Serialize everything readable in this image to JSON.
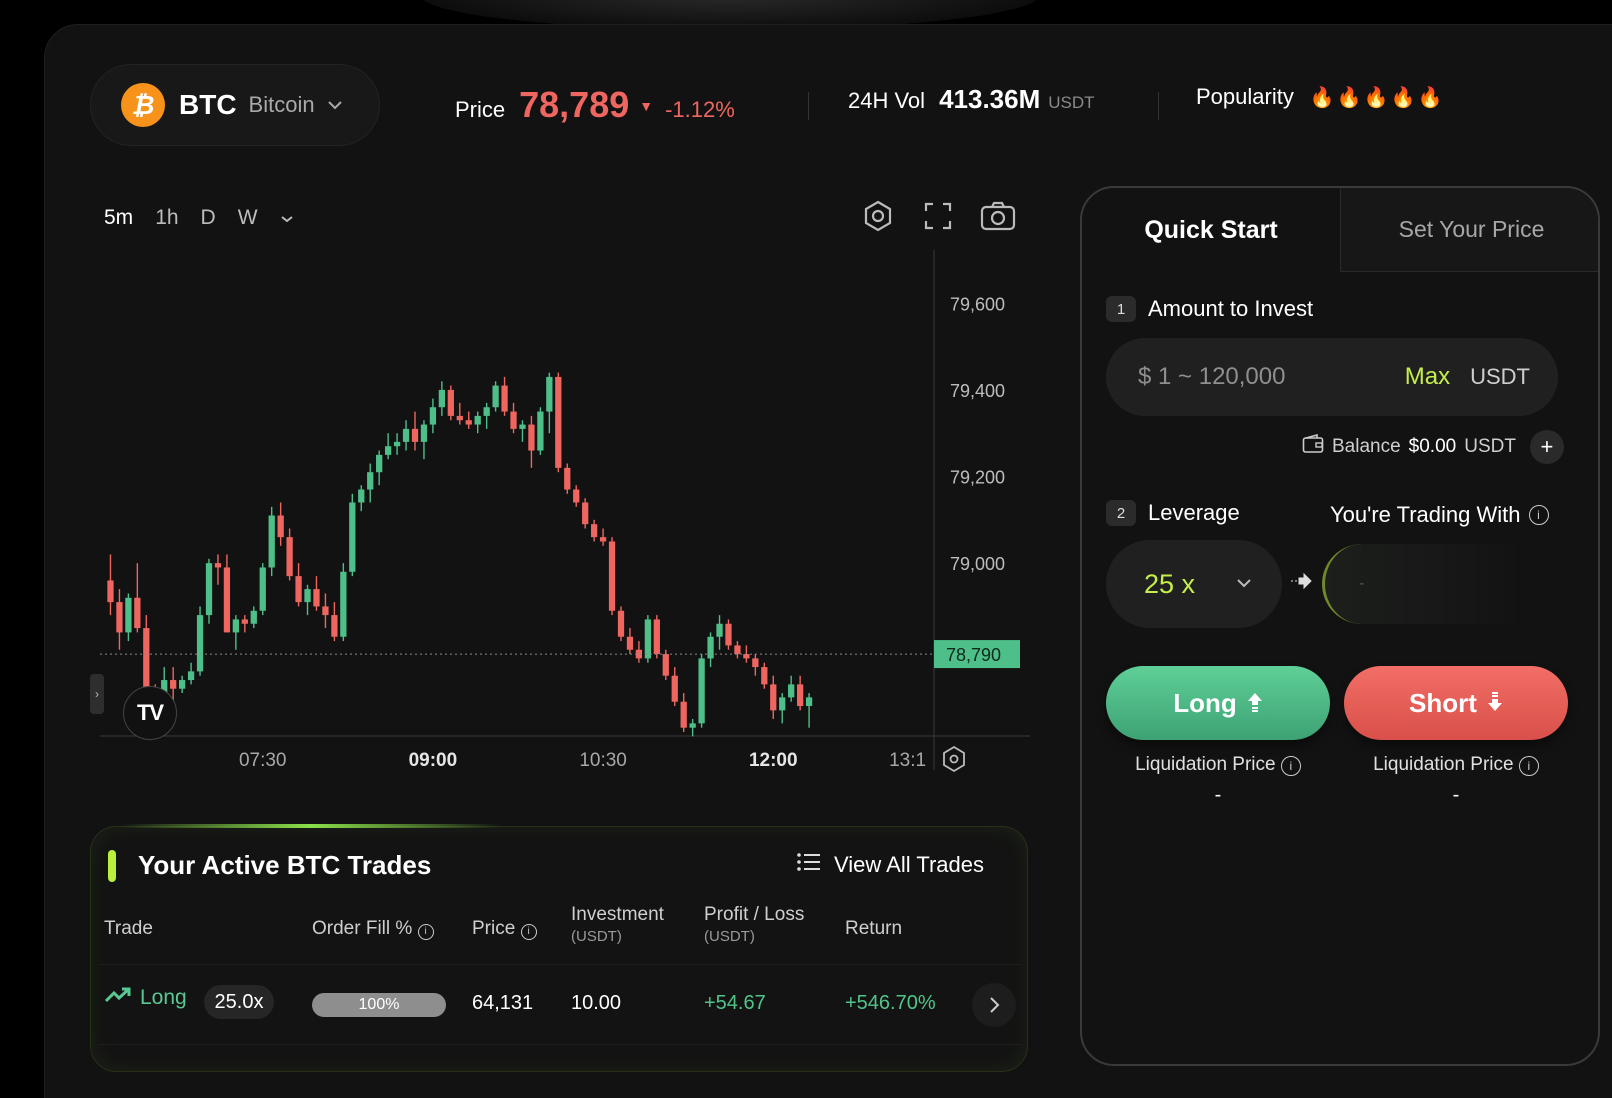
{
  "header": {
    "coin_symbol": "BTC",
    "coin_name": "Bitcoin",
    "price_label": "Price",
    "price_value": "78,789",
    "price_change": "-1.12%",
    "volume_label": "24H Vol",
    "volume_value": "413.36M",
    "volume_unit": "USDT",
    "popularity_label": "Popularity",
    "popularity_level": 5
  },
  "chart": {
    "timeframes": [
      "5m",
      "1h",
      "D",
      "W"
    ],
    "active_timeframe": "5m",
    "current_price_tag": "78,790",
    "colors": {
      "up": "#4fbf8a",
      "down": "#ef6660",
      "current": "#4fbf8a"
    }
  },
  "chart_data": {
    "type": "candlestick",
    "title": "",
    "ylim": [
      78550,
      79700
    ],
    "yticks": [
      "79,600",
      "79,400",
      "79,200",
      "79,000"
    ],
    "xticks": [
      {
        "label": "07:30",
        "bold": false,
        "index": 17
      },
      {
        "label": "09:00",
        "bold": true,
        "index": 36
      },
      {
        "label": "10:30",
        "bold": false,
        "index": 55
      },
      {
        "label": "12:00",
        "bold": true,
        "index": 74
      },
      {
        "label": "13:1",
        "bold": false,
        "index": 89
      }
    ],
    "current_price": 78790,
    "candles": [
      [
        78960,
        79020,
        78880,
        78910
      ],
      [
        78910,
        78940,
        78800,
        78840
      ],
      [
        78840,
        78930,
        78820,
        78920
      ],
      [
        78920,
        79000,
        78840,
        78850
      ],
      [
        78850,
        78880,
        78660,
        78700
      ],
      [
        78700,
        78720,
        78600,
        78620
      ],
      [
        78620,
        78760,
        78610,
        78730
      ],
      [
        78730,
        78760,
        78650,
        78710
      ],
      [
        78710,
        78740,
        78700,
        78730
      ],
      [
        78730,
        78770,
        78720,
        78750
      ],
      [
        78750,
        78900,
        78740,
        78880
      ],
      [
        78880,
        79010,
        78860,
        79000
      ],
      [
        79000,
        79020,
        78950,
        78990
      ],
      [
        78990,
        79020,
        78840,
        78840
      ],
      [
        78840,
        78880,
        78800,
        78870
      ],
      [
        78870,
        78880,
        78840,
        78860
      ],
      [
        78860,
        78900,
        78850,
        78890
      ],
      [
        78890,
        79000,
        78880,
        78990
      ],
      [
        78990,
        79130,
        78970,
        79110
      ],
      [
        79110,
        79140,
        79040,
        79060
      ],
      [
        79060,
        79080,
        78960,
        78970
      ],
      [
        78970,
        79000,
        78900,
        78910
      ],
      [
        78910,
        78950,
        78880,
        78940
      ],
      [
        78940,
        78970,
        78890,
        78900
      ],
      [
        78900,
        78930,
        78850,
        78880
      ],
      [
        78880,
        78910,
        78820,
        78830
      ],
      [
        78830,
        79000,
        78820,
        78980
      ],
      [
        78980,
        79160,
        78970,
        79140
      ],
      [
        79140,
        79180,
        79120,
        79170
      ],
      [
        79170,
        79230,
        79140,
        79210
      ],
      [
        79210,
        79260,
        79180,
        79250
      ],
      [
        79250,
        79300,
        79240,
        79270
      ],
      [
        79270,
        79300,
        79250,
        79280
      ],
      [
        79280,
        79330,
        79260,
        79310
      ],
      [
        79310,
        79350,
        79260,
        79280
      ],
      [
        79280,
        79330,
        79240,
        79320
      ],
      [
        79320,
        79380,
        79300,
        79360
      ],
      [
        79360,
        79420,
        79340,
        79400
      ],
      [
        79400,
        79410,
        79330,
        79340
      ],
      [
        79340,
        79370,
        79320,
        79330
      ],
      [
        79330,
        79350,
        79310,
        79320
      ],
      [
        79320,
        79350,
        79300,
        79340
      ],
      [
        79340,
        79370,
        79310,
        79360
      ],
      [
        79360,
        79420,
        79350,
        79410
      ],
      [
        79410,
        79430,
        79340,
        79350
      ],
      [
        79350,
        79370,
        79300,
        79310
      ],
      [
        79310,
        79330,
        79280,
        79320
      ],
      [
        79320,
        79340,
        79220,
        79260
      ],
      [
        79260,
        79360,
        79250,
        79350
      ],
      [
        79350,
        79440,
        79300,
        79430
      ],
      [
        79430,
        79440,
        79210,
        79220
      ],
      [
        79220,
        79230,
        79160,
        79170
      ],
      [
        79170,
        79180,
        79130,
        79140
      ],
      [
        79140,
        79150,
        79080,
        79090
      ],
      [
        79090,
        79100,
        79050,
        79060
      ],
      [
        79060,
        79080,
        79040,
        79050
      ],
      [
        79050,
        79060,
        78880,
        78890
      ],
      [
        78890,
        78900,
        78820,
        78830
      ],
      [
        78830,
        78850,
        78790,
        78800
      ],
      [
        78800,
        78820,
        78770,
        78780
      ],
      [
        78780,
        78880,
        78770,
        78870
      ],
      [
        78870,
        78880,
        78780,
        78790
      ],
      [
        78790,
        78800,
        78730,
        78740
      ],
      [
        78740,
        78760,
        78670,
        78680
      ],
      [
        78680,
        78700,
        78610,
        78620
      ],
      [
        78620,
        78640,
        78600,
        78630
      ],
      [
        78630,
        78790,
        78620,
        78780
      ],
      [
        78780,
        78840,
        78760,
        78830
      ],
      [
        78830,
        78880,
        78800,
        78860
      ],
      [
        78860,
        78870,
        78800,
        78810
      ],
      [
        78810,
        78820,
        78780,
        78790
      ],
      [
        78790,
        78810,
        78770,
        78780
      ],
      [
        78780,
        78790,
        78740,
        78760
      ],
      [
        78760,
        78770,
        78710,
        78720
      ],
      [
        78720,
        78740,
        78640,
        78660
      ],
      [
        78660,
        78700,
        78630,
        78690
      ],
      [
        78690,
        78740,
        78680,
        78720
      ],
      [
        78720,
        78740,
        78660,
        78670
      ],
      [
        78670,
        78700,
        78620,
        78690
      ]
    ]
  },
  "trades": {
    "title": "Your Active BTC Trades",
    "view_all": "View All Trades",
    "columns": {
      "trade": "Trade",
      "order_fill": "Order Fill %",
      "price": "Price",
      "investment": "Investment",
      "investment_unit": "(USDT)",
      "profit_loss": "Profit / Loss",
      "profit_loss_unit": "(USDT)",
      "return": "Return"
    },
    "rows": [
      {
        "side": "Long",
        "leverage": "25.0x",
        "order_fill": "100%",
        "price": "64,131",
        "investment": "10.00",
        "profit_loss": "+54.67",
        "return": "+546.70%"
      }
    ]
  },
  "order_panel": {
    "tab_quick": "Quick Start",
    "tab_set_price": "Set Your Price",
    "step1_num": "1",
    "step1_label": "Amount to Invest",
    "amount_placeholder": "$ 1 ~ 120,000",
    "max_label": "Max",
    "currency": "USDT",
    "balance_label": "Balance",
    "balance_value": "$0.00",
    "balance_unit": "USDT",
    "step2_num": "2",
    "step2_label": "Leverage",
    "trading_with_label": "You're Trading With",
    "trading_with_value": "-",
    "leverage_value": "25 x",
    "long_label": "Long",
    "short_label": "Short",
    "liq_label_long": "Liquidation Price",
    "liq_value_long": "-",
    "liq_label_short": "Liquidation Price",
    "liq_value_short": "-"
  }
}
